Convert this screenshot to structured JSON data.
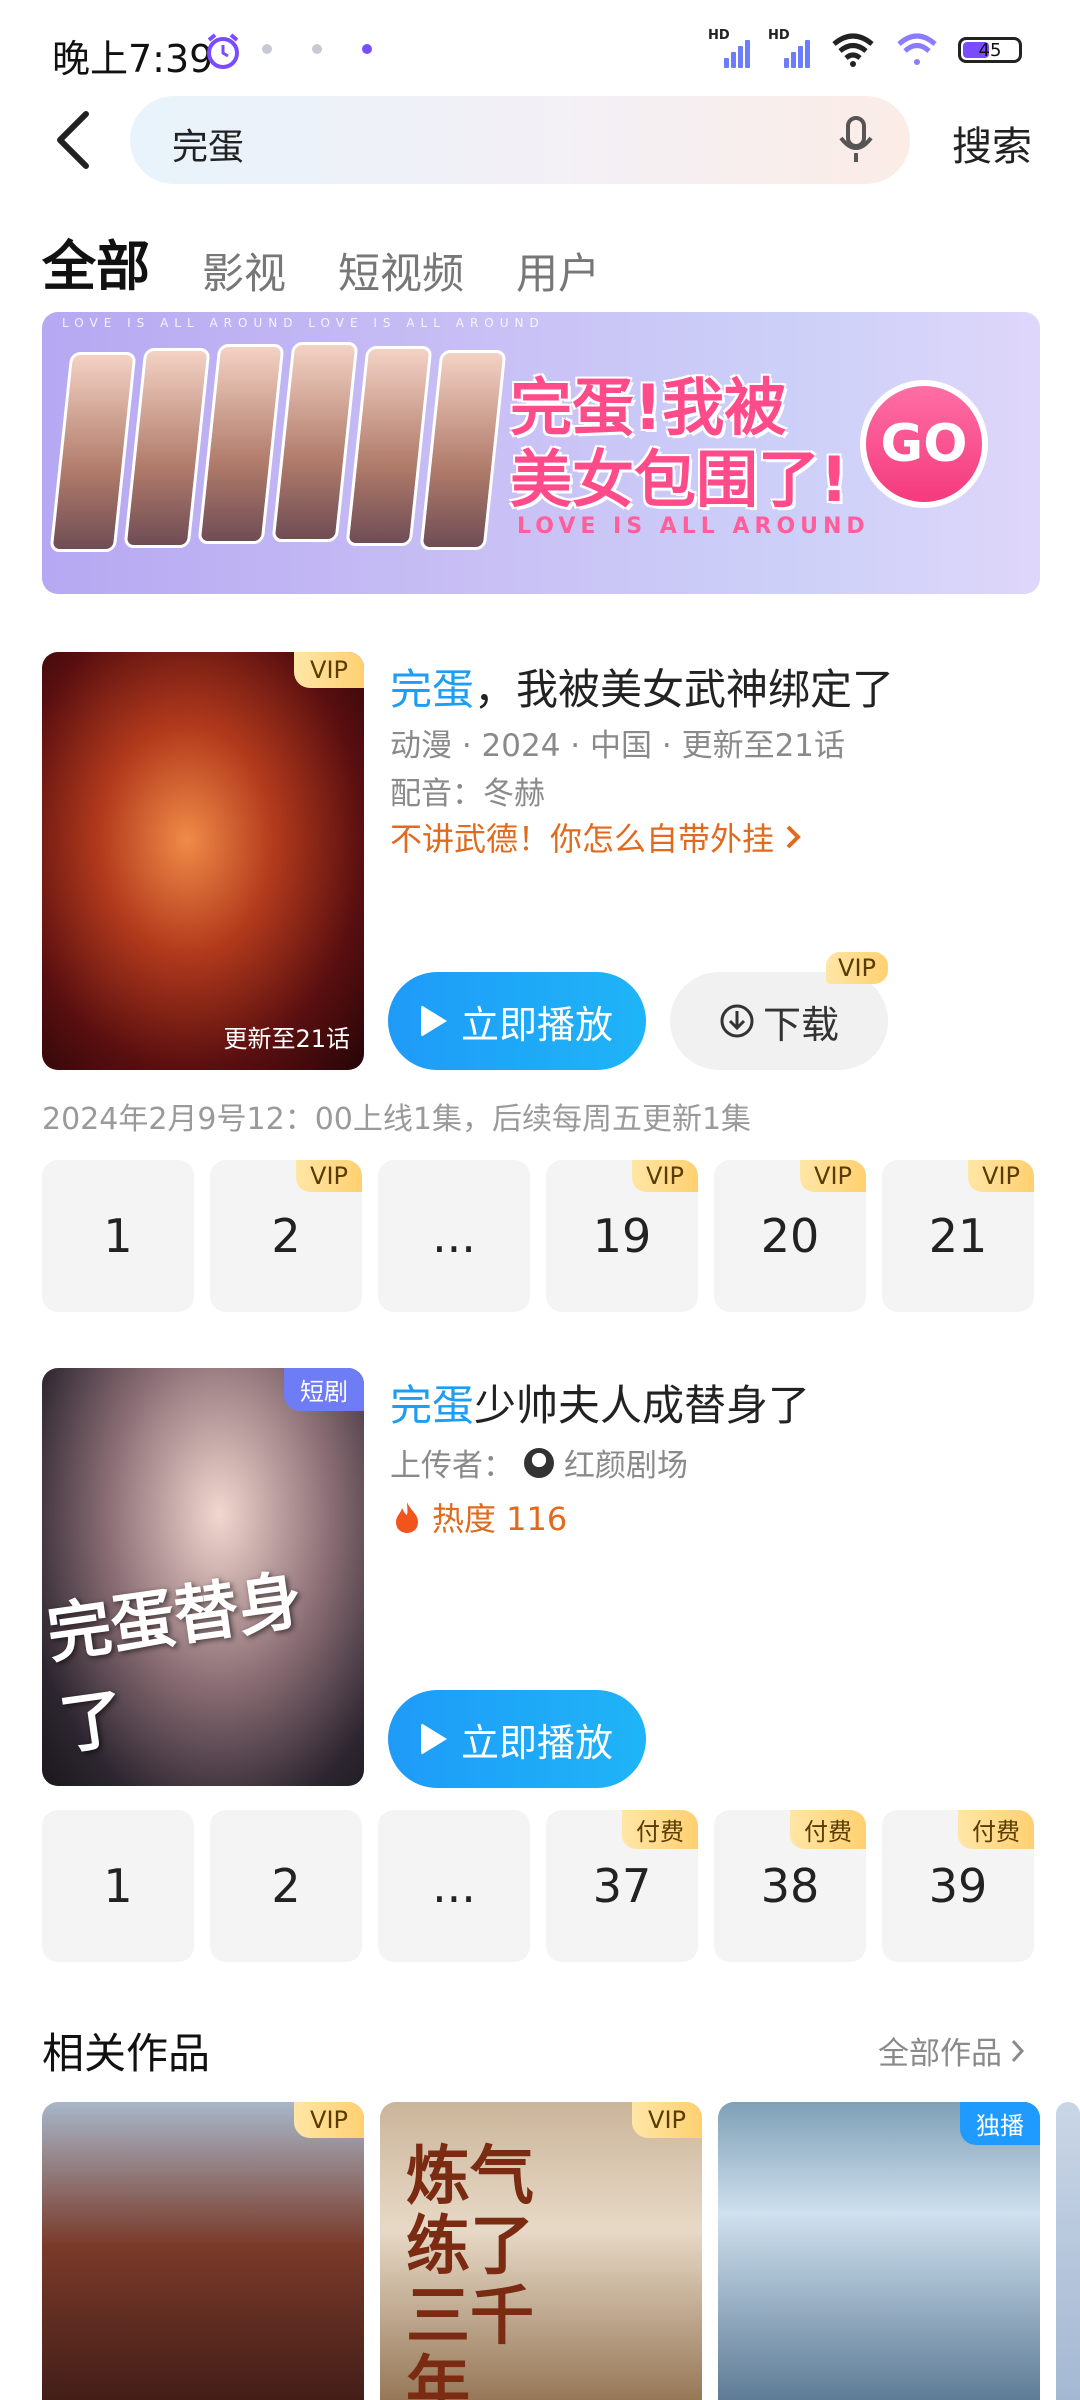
{
  "status_bar": {
    "time": "晚上7:39",
    "battery": "45",
    "hd_label": "HD"
  },
  "header": {
    "query": "完蛋",
    "search_label": "搜索"
  },
  "tabs": [
    {
      "label": "全部",
      "active": true
    },
    {
      "label": "影视",
      "active": false
    },
    {
      "label": "短视频",
      "active": false
    },
    {
      "label": "用户",
      "active": false
    }
  ],
  "banner": {
    "top_line": "LOVE IS ALL AROUND LOVE IS ALL AROUND",
    "title_line1": "完蛋!我被",
    "title_line2": "美女包围了!",
    "subtitle": "LOVE IS ALL AROUND",
    "go": "GO"
  },
  "result1": {
    "badge": "VIP",
    "title_highlight": "完蛋",
    "title_rest": "，我被美女武神绑定了",
    "meta": "动漫 · 2024 · 中国 · 更新至21话",
    "cast": "配音：冬赫",
    "tagline": "不讲武德！你怎么自带外挂",
    "poster_update": "更新至21话",
    "play_label": "立即播放",
    "download_label": "下载",
    "download_badge": "VIP",
    "schedule_note": "2024年2月9号12：00上线1集，后续每周五更新1集",
    "episodes": [
      {
        "label": "1",
        "tag": ""
      },
      {
        "label": "2",
        "tag": "VIP"
      },
      {
        "label": "...",
        "tag": ""
      },
      {
        "label": "19",
        "tag": "VIP"
      },
      {
        "label": "20",
        "tag": "VIP"
      },
      {
        "label": "21",
        "tag": "VIP"
      }
    ]
  },
  "result2": {
    "badge": "短剧",
    "title_highlight": "完蛋",
    "title_rest": "少帅夫人成替身了",
    "uploader_prefix": "上传者：",
    "uploader_name": "红颜剧场",
    "heat": "热度 116",
    "poster_text": "完蛋替身了",
    "play_label": "立即播放",
    "episodes": [
      {
        "label": "1",
        "tag": ""
      },
      {
        "label": "2",
        "tag": ""
      },
      {
        "label": "...",
        "tag": ""
      },
      {
        "label": "37",
        "tag": "付费"
      },
      {
        "label": "38",
        "tag": "付费"
      },
      {
        "label": "39",
        "tag": "付费"
      }
    ]
  },
  "related": {
    "title": "相关作品",
    "all_label": "全部作品",
    "items": [
      {
        "badge": "VIP"
      },
      {
        "badge": "VIP",
        "text": "炼气练了三千年"
      },
      {
        "badge": "独播"
      }
    ]
  },
  "colors": {
    "accent": "#1e9df5",
    "vip": "#ffd070",
    "tagline": "#e06a1e"
  }
}
